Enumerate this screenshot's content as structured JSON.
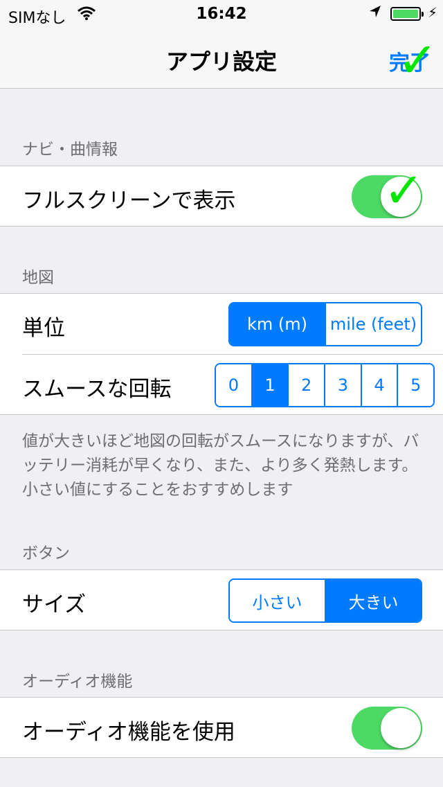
{
  "status_bar": {
    "carrier": "SIMなし",
    "time": "16:42"
  },
  "nav": {
    "title": "アプリ設定",
    "done_label": "完了"
  },
  "sections": {
    "navi": {
      "header": "ナビ・曲情報",
      "fullscreen_label": "フルスクリーンで表示",
      "fullscreen_on": true
    },
    "map": {
      "header": "地図",
      "unit_label": "単位",
      "unit_options": [
        "km (m)",
        "mile (feet)"
      ],
      "unit_selected": "km (m)",
      "rotation_label": "スムースな回転",
      "rotation_options": [
        "0",
        "1",
        "2",
        "3",
        "4",
        "5"
      ],
      "rotation_selected": "1",
      "footer": "値が大きいほど地図の回転がスムースになりますが、バッテリー消耗が早くなり、また、より多く発熱します。小さい値にすることをおすすめします"
    },
    "button": {
      "header": "ボタン",
      "size_label": "サイズ",
      "size_options": [
        "小さい",
        "大きい"
      ],
      "size_selected": "大きい"
    },
    "audio": {
      "header": "オーディオ機能",
      "use_label": "オーディオ機能を使用",
      "use_on": true
    }
  },
  "colors": {
    "accent": "#007aff",
    "switch_on": "#4cd964",
    "background": "#efeff4"
  }
}
